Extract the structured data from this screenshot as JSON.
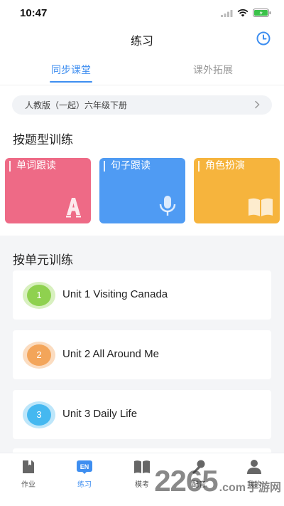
{
  "status_bar": {
    "time": "10:47"
  },
  "nav": {
    "title": "练习"
  },
  "tabs": [
    {
      "label": "同步课堂",
      "active": true
    },
    {
      "label": "课外拓展",
      "active": false
    }
  ],
  "book_selector": {
    "label": "人教版（一起）六年级下册"
  },
  "question_type_section": {
    "title": "按题型训练",
    "cards": [
      {
        "label": "单词跟读",
        "icon": "letter-a-icon",
        "color": "#ee6a86"
      },
      {
        "label": "句子跟读",
        "icon": "microphone-icon",
        "color": "#4f9bf3"
      },
      {
        "label": "角色扮演",
        "icon": "book-icon",
        "color": "#f6b43d"
      }
    ]
  },
  "unit_section": {
    "title": "按单元训练",
    "units": [
      {
        "number": "1",
        "title": "Unit 1 Visiting Canada",
        "color": "#8fd14f",
        "ring": "#d8f0bf"
      },
      {
        "number": "2",
        "title": "Unit 2 All Around Me",
        "color": "#f3a55a",
        "ring": "#fbdcc0"
      },
      {
        "number": "3",
        "title": "Unit 3 Daily Life",
        "color": "#45b8f0",
        "ring": "#bde6fa"
      }
    ]
  },
  "tab_bar": {
    "items": [
      {
        "label": "作业",
        "icon": "homework-icon"
      },
      {
        "label": "练习",
        "icon": "en-practice-icon",
        "badge": "EN",
        "active": true
      },
      {
        "label": "模考",
        "icon": "exam-book-icon"
      },
      {
        "label": "配音",
        "icon": "microphone-icon"
      },
      {
        "label": "我的",
        "icon": "user-icon"
      }
    ]
  },
  "watermark": {
    "number": "2265",
    "suffix": ".com",
    "text": "手游网"
  },
  "colors": {
    "accent": "#3e8ef0"
  }
}
